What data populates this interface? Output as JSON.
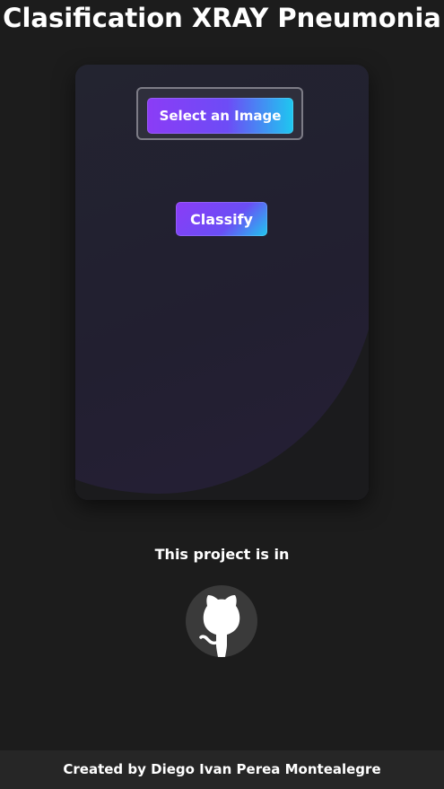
{
  "header": {
    "title": "Clasification XRAY Pneumonia"
  },
  "card": {
    "select_label": "Select an Image",
    "classify_label": "Classify"
  },
  "project": {
    "text": "This project is in",
    "link_icon": "github-icon"
  },
  "footer": {
    "text": "Created by Diego Ivan Perea Montealegre"
  },
  "colors": {
    "background": "#1c1c1c",
    "card": "#232430",
    "button_start": "#8b3cf6",
    "button_end": "#1ec8f0",
    "footer": "#262626"
  }
}
